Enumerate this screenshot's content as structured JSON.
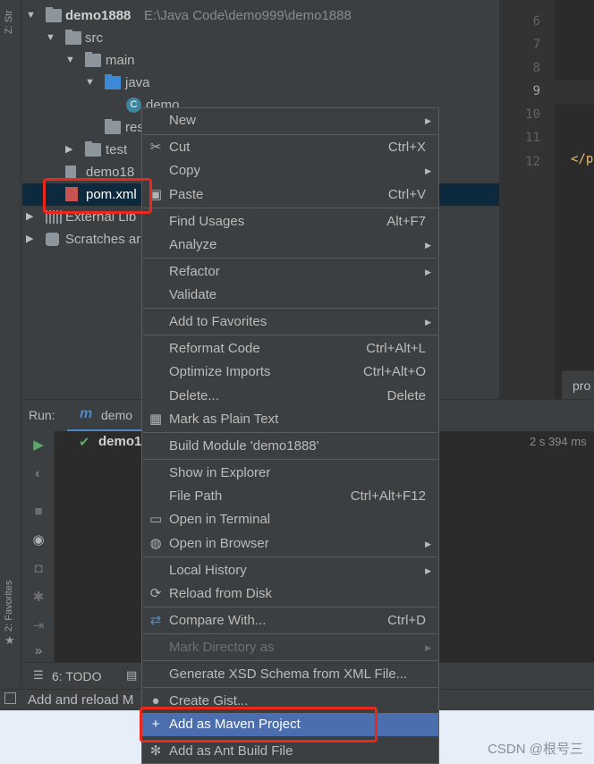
{
  "left_strip": {
    "structure_label": "Z: Str",
    "favorites_label": "2: Favorites"
  },
  "project_tree": {
    "rows": [
      {
        "label": "demo1888",
        "path": "E:\\Java Code\\demo999\\demo1888"
      },
      {
        "label": "src"
      },
      {
        "label": "main"
      },
      {
        "label": "java"
      },
      {
        "label": "demo"
      },
      {
        "label": "res"
      },
      {
        "label": "test"
      },
      {
        "label": "demo18"
      },
      {
        "label": "pom.xml"
      },
      {
        "label": "External Lib"
      },
      {
        "label": "Scratches ar"
      }
    ]
  },
  "editor": {
    "line_numbers": [
      "6",
      "7",
      "8",
      "9",
      "10",
      "11",
      "12"
    ],
    "code_fragment": "</p",
    "tab_label": "pro"
  },
  "run_panel": {
    "label": "Run:",
    "tab_label": "demo",
    "tree_item": "demo1",
    "elapsed": "2 s 394 ms"
  },
  "bottom_tabs": {
    "todo": "6: TODO"
  },
  "status_bar": {
    "message": "Add and reload M"
  },
  "context_menu": {
    "items": [
      {
        "label": "New",
        "shortcut": "",
        "submenu": true
      },
      {
        "label": "Cut",
        "shortcut": "Ctrl+X",
        "icon": "scissors-icon"
      },
      {
        "label": "Copy",
        "shortcut": "",
        "submenu": true
      },
      {
        "label": "Paste",
        "shortcut": "Ctrl+V",
        "icon": "clipboard-icon"
      },
      {
        "label": "Find Usages",
        "shortcut": "Alt+F7"
      },
      {
        "label": "Analyze",
        "shortcut": "",
        "submenu": true
      },
      {
        "label": "Refactor",
        "shortcut": "",
        "submenu": true
      },
      {
        "label": "Validate",
        "shortcut": ""
      },
      {
        "label": "Add to Favorites",
        "shortcut": "",
        "submenu": true
      },
      {
        "label": "Reformat Code",
        "shortcut": "Ctrl+Alt+L"
      },
      {
        "label": "Optimize Imports",
        "shortcut": "Ctrl+Alt+O"
      },
      {
        "label": "Delete...",
        "shortcut": "Delete"
      },
      {
        "label": "Mark as Plain Text",
        "shortcut": "",
        "icon": "plain-text-icon"
      },
      {
        "label": "Build Module 'demo1888'",
        "shortcut": ""
      },
      {
        "label": "Show in Explorer",
        "shortcut": ""
      },
      {
        "label": "File Path",
        "shortcut": "Ctrl+Alt+F12"
      },
      {
        "label": "Open in Terminal",
        "shortcut": "",
        "icon": "terminal-icon"
      },
      {
        "label": "Open in Browser",
        "shortcut": "",
        "submenu": true,
        "icon": "globe-icon"
      },
      {
        "label": "Local History",
        "shortcut": "",
        "submenu": true
      },
      {
        "label": "Reload from Disk",
        "shortcut": "",
        "icon": "reload-icon"
      },
      {
        "label": "Compare With...",
        "shortcut": "Ctrl+D",
        "icon": "compare-icon"
      },
      {
        "label": "Mark Directory as",
        "shortcut": "",
        "submenu": true,
        "disabled": true
      },
      {
        "label": "Generate XSD Schema from XML File...",
        "shortcut": ""
      },
      {
        "label": "Create Gist...",
        "shortcut": "",
        "icon": "github-icon"
      },
      {
        "label": "Add as Maven Project",
        "shortcut": "",
        "icon": "plus-icon",
        "highlighted": true
      },
      {
        "label": "Add as Ant Build File",
        "shortcut": "",
        "icon": "ant-icon"
      }
    ]
  },
  "watermark": "CSDN @根号三",
  "colors": {
    "selection": "#4b6eaf",
    "annotation": "#e8271d",
    "tree_selection": "#0d293e"
  }
}
